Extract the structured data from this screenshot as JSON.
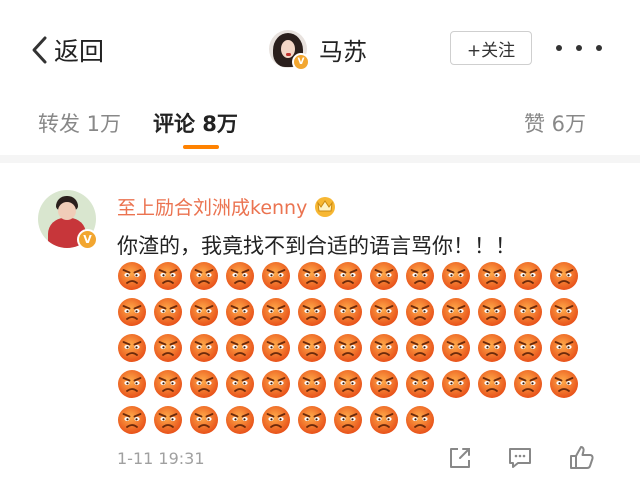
{
  "nav": {
    "back_label": "返回",
    "profile_name": "马苏",
    "follow_label": "+关注"
  },
  "tabs": [
    {
      "label": "转发 1万",
      "active": false
    },
    {
      "label": "评论 8万",
      "active": true
    },
    {
      "label": "赞 6万",
      "active": false
    }
  ],
  "comment": {
    "username": "至上励合刘洲成kenny",
    "text": "你渣的，我竟找不到合适的语言骂你！！！",
    "emoji_name": "angry-emoji",
    "emoji_count": 61,
    "timestamp": "1-11 19:31"
  },
  "icons": {
    "back": "chevron-left-icon",
    "verified": "verified-v-icon",
    "crown": "crown-badge-icon",
    "share": "share-icon",
    "reply": "comment-icon",
    "like": "thumbs-up-icon"
  },
  "colors": {
    "accent": "#ff8200",
    "username": "#eb7350",
    "verified": "#f2a630"
  }
}
